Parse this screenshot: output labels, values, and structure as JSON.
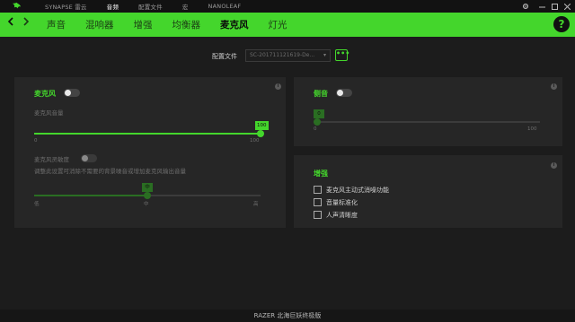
{
  "topnav": {
    "items": [
      {
        "label": "SYNAPSE 雷云",
        "active": false
      },
      {
        "label": "音频",
        "active": true
      },
      {
        "label": "配置文件",
        "active": false
      },
      {
        "label": "宏",
        "active": false
      },
      {
        "label": "NANOLEAF",
        "active": false
      }
    ]
  },
  "window": {
    "settings_icon": "gear-icon",
    "minimize_icon": "minimize-icon",
    "maximize_icon": "maximize-icon",
    "close_icon": "close-icon"
  },
  "subnav": {
    "items": [
      "声音",
      "混响器",
      "增强",
      "均衡器",
      "麦克风",
      "灯光"
    ],
    "active": "麦克风"
  },
  "help": {
    "label": "?"
  },
  "profile": {
    "label": "配置文件",
    "value": "SC-201711121619-De...",
    "more_label": "•••"
  },
  "mic": {
    "title": "麦克风",
    "enabled": false,
    "volume_label": "麦克风音量",
    "volume_value": "100",
    "volume_min": "0",
    "volume_max": "100",
    "sensitivity_label": "麦克风灵敏度",
    "sensitivity_enabled": false,
    "sensitivity_desc": "调整此设置可消除不需要的背景噪音或增加麦克风输出音量",
    "sensitivity_value": "中",
    "sensitivity_low": "低",
    "sensitivity_mid": "中",
    "sensitivity_high": "高",
    "info": "i"
  },
  "sidetone": {
    "title": "侧音",
    "enabled": false,
    "value": "0",
    "min": "0",
    "max": "100",
    "info": "i"
  },
  "enhance": {
    "title": "增强",
    "info": "i",
    "options": [
      {
        "label": "麦克风主动式消噪功能",
        "checked": false
      },
      {
        "label": "音量标准化",
        "checked": false
      },
      {
        "label": "人声清晰度",
        "checked": false
      }
    ]
  },
  "footer": {
    "device": "RAZER 北海巨妖终极版"
  },
  "colors": {
    "accent": "#44d62c",
    "background": "#1c1c1c",
    "panel": "#262626"
  }
}
